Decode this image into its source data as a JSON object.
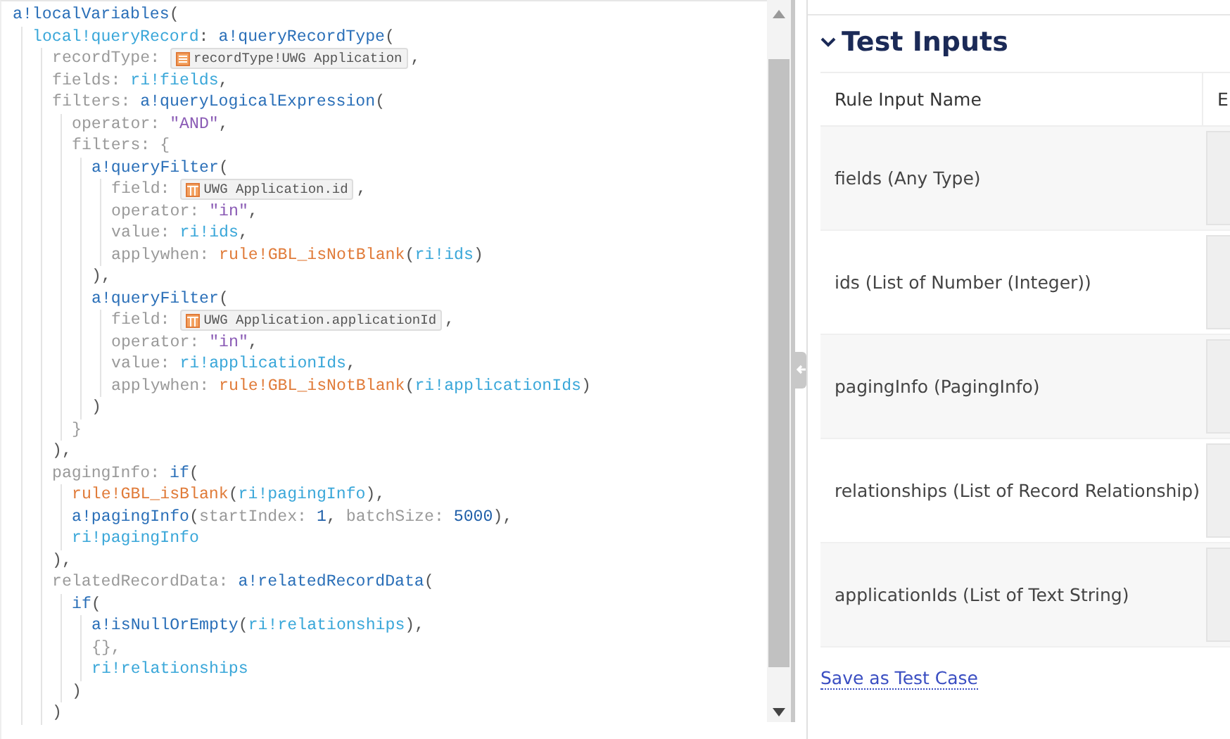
{
  "editor": {
    "lines": [
      {
        "tokens": [
          {
            "kind": "fn",
            "t": "a!localVariables"
          },
          {
            "kind": "punct",
            "t": "("
          }
        ],
        "children": [
          {
            "tokens": [
              {
                "kind": "var",
                "t": "local!queryRecord"
              },
              {
                "kind": "punct",
                "t": ": "
              },
              {
                "kind": "fn",
                "t": "a!queryRecordType"
              },
              {
                "kind": "punct",
                "t": "("
              }
            ],
            "children": [
              {
                "tokens": [
                  {
                    "kind": "key",
                    "t": "recordType: "
                  },
                  {
                    "kind": "record",
                    "t": "recordType!UWG Application"
                  },
                  {
                    "kind": "punct",
                    "t": ","
                  }
                ]
              },
              {
                "tokens": [
                  {
                    "kind": "key",
                    "t": "fields: "
                  },
                  {
                    "kind": "var",
                    "t": "ri!fields"
                  },
                  {
                    "kind": "punct",
                    "t": ","
                  }
                ]
              },
              {
                "tokens": [
                  {
                    "kind": "key",
                    "t": "filters: "
                  },
                  {
                    "kind": "fn",
                    "t": "a!queryLogicalExpression"
                  },
                  {
                    "kind": "punct",
                    "t": "("
                  }
                ],
                "children": [
                  {
                    "tokens": [
                      {
                        "kind": "key",
                        "t": "operator: "
                      },
                      {
                        "kind": "str",
                        "t": "\"AND\""
                      },
                      {
                        "kind": "punct",
                        "t": ","
                      }
                    ]
                  },
                  {
                    "tokens": [
                      {
                        "kind": "key",
                        "t": "filters: {"
                      }
                    ],
                    "children": [
                      {
                        "tokens": [
                          {
                            "kind": "fn",
                            "t": "a!queryFilter"
                          },
                          {
                            "kind": "punct",
                            "t": "("
                          }
                        ],
                        "children": [
                          {
                            "tokens": [
                              {
                                "kind": "key",
                                "t": "field: "
                              },
                              {
                                "kind": "field",
                                "t": "UWG Application.id"
                              },
                              {
                                "kind": "punct",
                                "t": ","
                              }
                            ]
                          },
                          {
                            "tokens": [
                              {
                                "kind": "key",
                                "t": "operator: "
                              },
                              {
                                "kind": "str",
                                "t": "\"in\""
                              },
                              {
                                "kind": "punct",
                                "t": ","
                              }
                            ]
                          },
                          {
                            "tokens": [
                              {
                                "kind": "key",
                                "t": "value: "
                              },
                              {
                                "kind": "var",
                                "t": "ri!ids"
                              },
                              {
                                "kind": "punct",
                                "t": ","
                              }
                            ]
                          },
                          {
                            "tokens": [
                              {
                                "kind": "key",
                                "t": "applywhen: "
                              },
                              {
                                "kind": "rule",
                                "t": "rule!GBL_isNotBlank"
                              },
                              {
                                "kind": "punct",
                                "t": "("
                              },
                              {
                                "kind": "var",
                                "t": "ri!ids"
                              },
                              {
                                "kind": "punct",
                                "t": ")"
                              }
                            ]
                          }
                        ]
                      },
                      {
                        "tokens": [
                          {
                            "kind": "punct",
                            "t": "),"
                          }
                        ]
                      },
                      {
                        "tokens": [
                          {
                            "kind": "fn",
                            "t": "a!queryFilter"
                          },
                          {
                            "kind": "punct",
                            "t": "("
                          }
                        ],
                        "children": [
                          {
                            "tokens": [
                              {
                                "kind": "key",
                                "t": "field: "
                              },
                              {
                                "kind": "field",
                                "t": "UWG Application.applicationId"
                              },
                              {
                                "kind": "punct",
                                "t": ","
                              }
                            ]
                          },
                          {
                            "tokens": [
                              {
                                "kind": "key",
                                "t": "operator: "
                              },
                              {
                                "kind": "str",
                                "t": "\"in\""
                              },
                              {
                                "kind": "punct",
                                "t": ","
                              }
                            ]
                          },
                          {
                            "tokens": [
                              {
                                "kind": "key",
                                "t": "value: "
                              },
                              {
                                "kind": "var",
                                "t": "ri!applicationIds"
                              },
                              {
                                "kind": "punct",
                                "t": ","
                              }
                            ]
                          },
                          {
                            "tokens": [
                              {
                                "kind": "key",
                                "t": "applywhen: "
                              },
                              {
                                "kind": "rule",
                                "t": "rule!GBL_isNotBlank"
                              },
                              {
                                "kind": "punct",
                                "t": "("
                              },
                              {
                                "kind": "var",
                                "t": "ri!applicationIds"
                              },
                              {
                                "kind": "punct",
                                "t": ")"
                              }
                            ]
                          }
                        ]
                      },
                      {
                        "tokens": [
                          {
                            "kind": "punct",
                            "t": ")"
                          }
                        ]
                      }
                    ]
                  },
                  {
                    "tokens": [
                      {
                        "kind": "key",
                        "t": "}"
                      }
                    ]
                  }
                ]
              },
              {
                "tokens": [
                  {
                    "kind": "punct",
                    "t": "),"
                  }
                ]
              },
              {
                "tokens": [
                  {
                    "kind": "key",
                    "t": "pagingInfo: "
                  },
                  {
                    "kind": "fn",
                    "t": "if"
                  },
                  {
                    "kind": "punct",
                    "t": "("
                  }
                ],
                "children": [
                  {
                    "tokens": [
                      {
                        "kind": "rule",
                        "t": "rule!GBL_isBlank"
                      },
                      {
                        "kind": "punct",
                        "t": "("
                      },
                      {
                        "kind": "var",
                        "t": "ri!pagingInfo"
                      },
                      {
                        "kind": "punct",
                        "t": "),"
                      }
                    ]
                  },
                  {
                    "tokens": [
                      {
                        "kind": "fn",
                        "t": "a!pagingInfo"
                      },
                      {
                        "kind": "punct",
                        "t": "("
                      },
                      {
                        "kind": "key",
                        "t": "startIndex: "
                      },
                      {
                        "kind": "num",
                        "t": "1"
                      },
                      {
                        "kind": "punct",
                        "t": ", "
                      },
                      {
                        "kind": "key",
                        "t": "batchSize: "
                      },
                      {
                        "kind": "num",
                        "t": "5000"
                      },
                      {
                        "kind": "punct",
                        "t": "),"
                      }
                    ]
                  },
                  {
                    "tokens": [
                      {
                        "kind": "var",
                        "t": "ri!pagingInfo"
                      }
                    ]
                  }
                ]
              },
              {
                "tokens": [
                  {
                    "kind": "punct",
                    "t": "),"
                  }
                ]
              },
              {
                "tokens": [
                  {
                    "kind": "key",
                    "t": "relatedRecordData: "
                  },
                  {
                    "kind": "fn",
                    "t": "a!relatedRecordData"
                  },
                  {
                    "kind": "punct",
                    "t": "("
                  }
                ],
                "children": [
                  {
                    "tokens": [
                      {
                        "kind": "fn",
                        "t": "if"
                      },
                      {
                        "kind": "punct",
                        "t": "("
                      }
                    ],
                    "children": [
                      {
                        "tokens": [
                          {
                            "kind": "fn",
                            "t": "a!isNullOrEmpty"
                          },
                          {
                            "kind": "punct",
                            "t": "("
                          },
                          {
                            "kind": "var",
                            "t": "ri!relationships"
                          },
                          {
                            "kind": "punct",
                            "t": "),"
                          }
                        ]
                      },
                      {
                        "tokens": [
                          {
                            "kind": "key",
                            "t": "{},"
                          }
                        ]
                      },
                      {
                        "tokens": [
                          {
                            "kind": "var",
                            "t": "ri!relationships"
                          }
                        ]
                      }
                    ]
                  },
                  {
                    "tokens": [
                      {
                        "kind": "punct",
                        "t": ")"
                      }
                    ]
                  }
                ]
              },
              {
                "tokens": [
                  {
                    "kind": "punct",
                    "t": ")"
                  }
                ]
              }
            ]
          }
        ]
      }
    ]
  },
  "test_inputs": {
    "title": "Test Inputs",
    "expanded": true,
    "table": {
      "columns": [
        "Rule Input Name",
        "E"
      ],
      "rows": [
        {
          "name": "fields (Any Type)"
        },
        {
          "name": "ids (List of Number (Integer))"
        },
        {
          "name": "pagingInfo (PagingInfo)"
        },
        {
          "name": "relationships (List of Record Relationship)"
        },
        {
          "name": "applicationIds (List of Text String)"
        }
      ]
    },
    "link": "Save as Test Case"
  }
}
